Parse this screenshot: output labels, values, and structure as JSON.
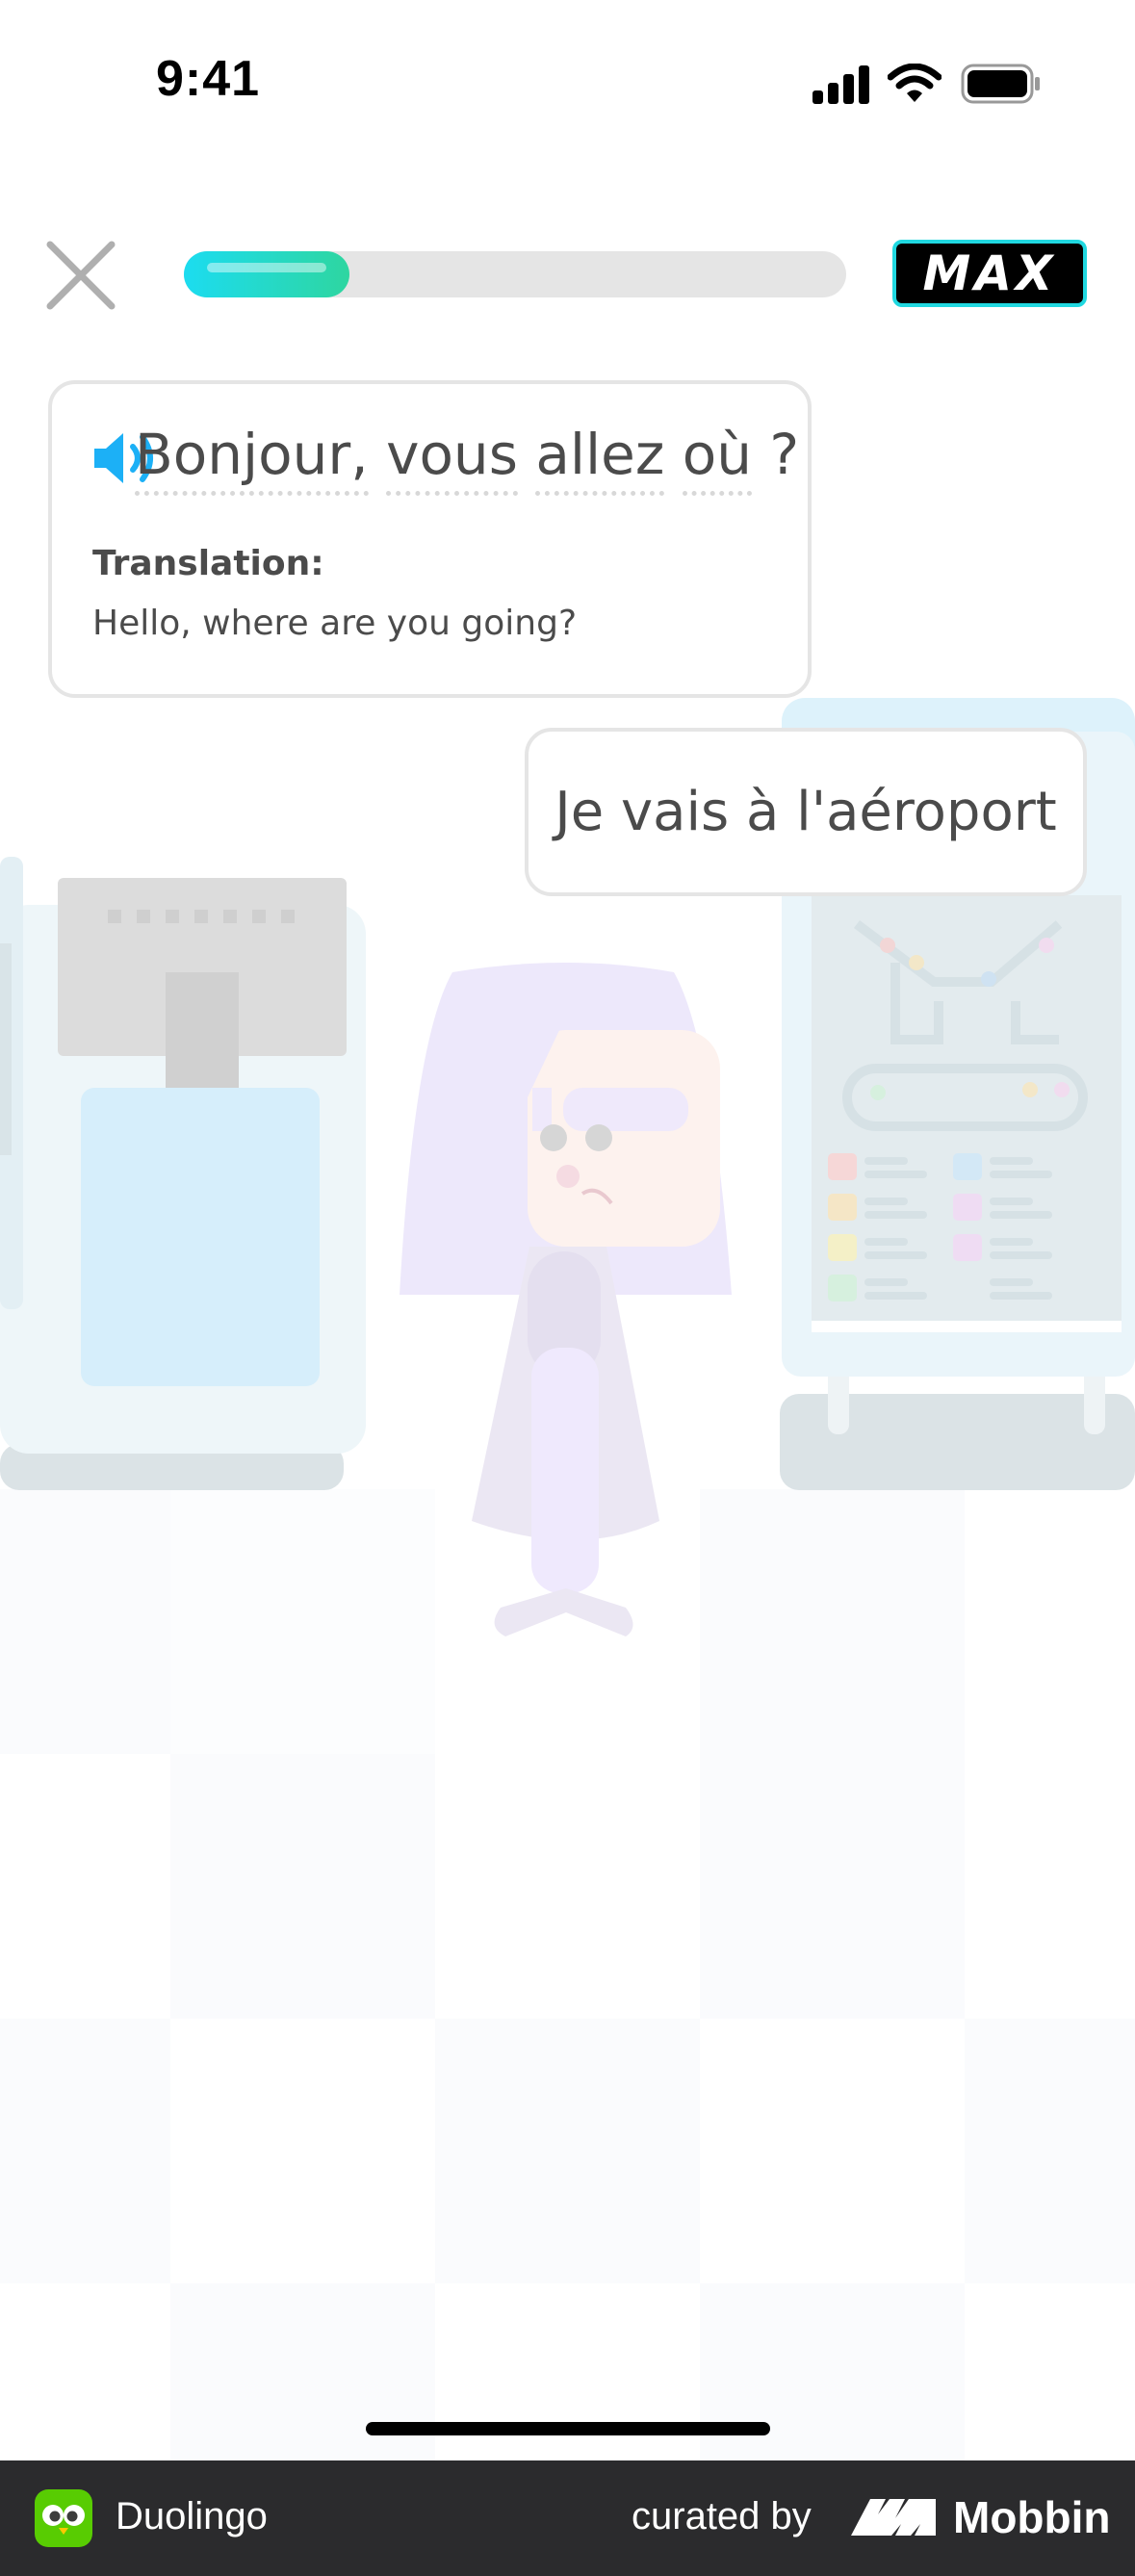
{
  "status_bar": {
    "time": "9:41"
  },
  "lesson": {
    "progress": 0.25,
    "badge_label": "MAX"
  },
  "dialog": {
    "prompt_words": [
      "Bonjour,",
      "vous",
      "allez",
      "où",
      "?"
    ],
    "translation_label": "Translation:",
    "translation_text": "Hello, where are you going?",
    "reply": "Je vais à l'aéroport"
  },
  "colors": {
    "accent": "#1cb0f6",
    "progress_start": "#1cdcf0",
    "progress_end": "#2ed6a0",
    "text": "#4b4b4b"
  },
  "footer": {
    "app_name": "Duolingo",
    "curated_by": "curated by",
    "brand": "Mobbin"
  }
}
